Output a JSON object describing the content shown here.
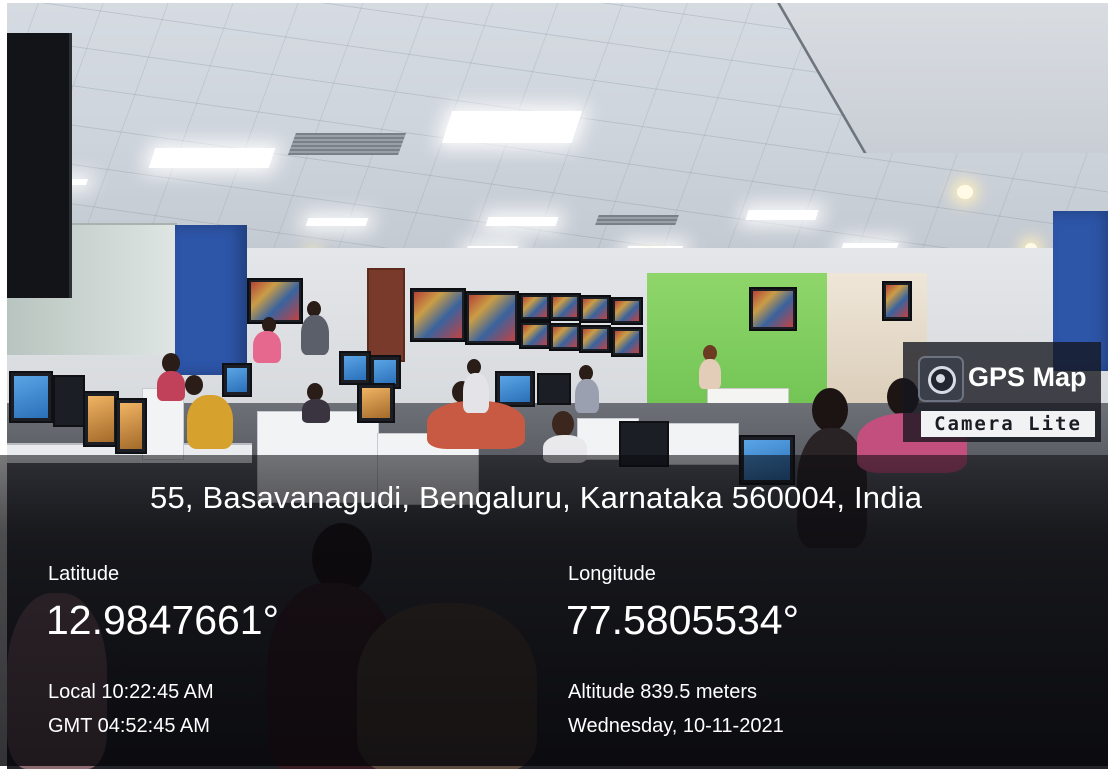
{
  "overlay": {
    "address": "55, Basavanagudi, Bengaluru, Karnataka 560004, India",
    "latitude_label": "Latitude",
    "latitude_value": "12.9847661°",
    "longitude_label": "Longitude",
    "longitude_value": "77.5805534°",
    "local_time": "Local 10:22:45 AM",
    "gmt_time": "GMT 04:52:45 AM",
    "altitude": "Altitude 839.5 meters",
    "date": "Wednesday, 10-11-2021"
  },
  "logo": {
    "title": "GPS Map",
    "subtitle": "Camera Lite",
    "icon": "camera-lens-icon"
  },
  "colors": {
    "overlay_text": "#ffffff",
    "logo_badge_bg": "#f1f2f4",
    "accent_blue_pillar": "#2d55a8",
    "green_studio": "#7ac95e"
  }
}
